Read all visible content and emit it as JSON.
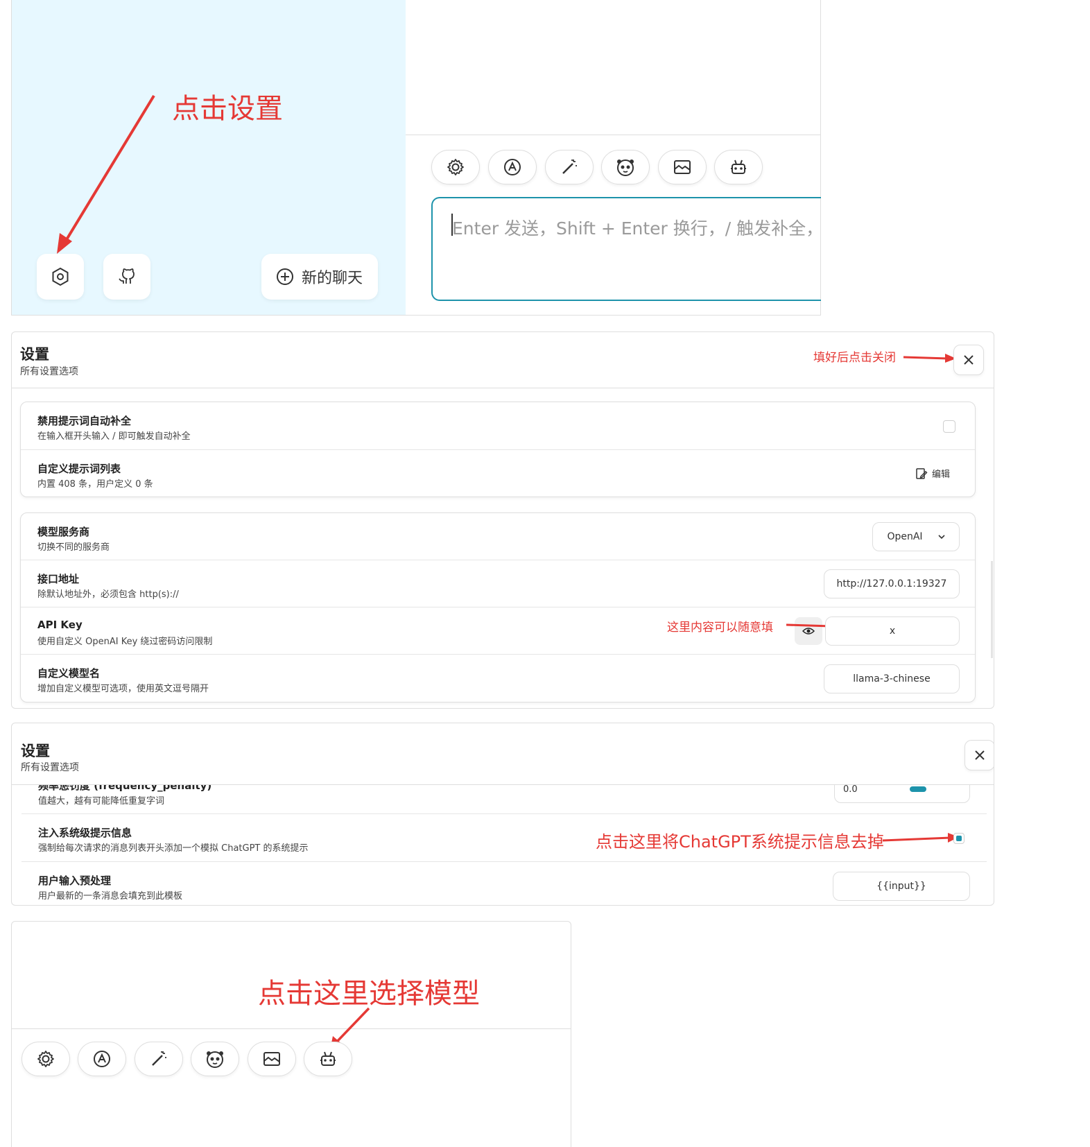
{
  "top": {
    "annotation_settings": "点击设置",
    "new_chat_label": "新的聊天",
    "input_placeholder": "Enter 发送，Shift + Enter 换行，/ 触发补全，"
  },
  "settings1": {
    "title": "设置",
    "subtitle": "所有设置选项",
    "annotation_close": "填好后点击关闭",
    "rows_a": [
      {
        "title": "禁用提示词自动补全",
        "sub": "在输入框开头输入 / 即可触发自动补全"
      },
      {
        "title": "自定义提示词列表",
        "sub": "内置 408 条，用户定义 0 条",
        "action": "编辑"
      }
    ],
    "rows_b": [
      {
        "title": "模型服务商",
        "sub": "切换不同的服务商",
        "value": "OpenAI"
      },
      {
        "title": "接口地址",
        "sub": "除默认地址外，必须包含 http(s)://",
        "value": "http://127.0.0.1:19327"
      },
      {
        "title": "API Key",
        "sub": "使用自定义 OpenAI Key 绕过密码访问限制",
        "value": "x"
      },
      {
        "title": "自定义模型名",
        "sub": "增加自定义模型可选项，使用英文逗号隔开",
        "value": "llama-3-chinese"
      }
    ],
    "annotation_apikey": "这里内容可以随意填"
  },
  "settings2": {
    "title": "设置",
    "subtitle": "所有设置选项",
    "partial_title": "频率惩罚度 (frequency_penalty)",
    "partial_sub": "值越大，越有可能降低重复字词",
    "partial_value": "0.0",
    "rows": [
      {
        "title": "注入系统级提示信息",
        "sub": "强制给每次请求的消息列表开头添加一个模拟 ChatGPT 的系统提示"
      },
      {
        "title": "用户输入预处理",
        "sub": "用户最新的一条消息会填充到此模板",
        "value": "{{input}}"
      }
    ],
    "annotation_system": "点击这里将ChatGPT系统提示信息去掉"
  },
  "bottom": {
    "annotation_model": "点击这里选择模型"
  },
  "colors": {
    "sidebar_bg": "#e7f8ff",
    "accent": "#1d93ab",
    "annotation": "#e53935"
  },
  "icons": [
    "gear-icon",
    "prompt-icon",
    "magic-wand-icon",
    "mask-icon",
    "image-icon",
    "robot-icon",
    "github-icon",
    "plus-circle-icon",
    "eye-icon",
    "edit-icon",
    "chevron-down-icon",
    "close-icon"
  ]
}
